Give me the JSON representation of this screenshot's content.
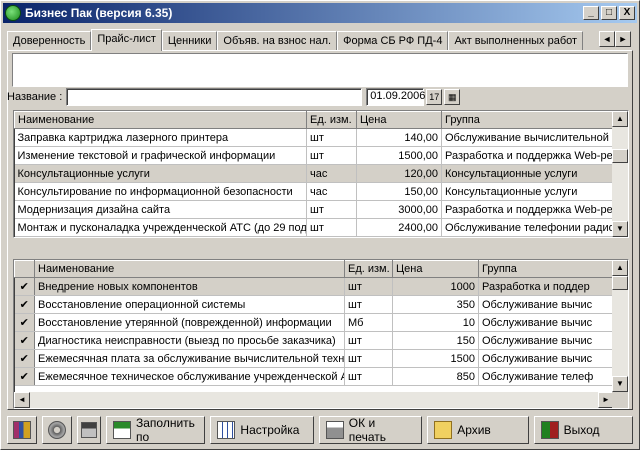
{
  "window": {
    "title": "Бизнес Пак (версия 6.35)",
    "min": "_",
    "max": "□",
    "close": "X"
  },
  "tabs": [
    {
      "label": "Доверенность"
    },
    {
      "label": "Прайс-лист"
    },
    {
      "label": "Ценники"
    },
    {
      "label": "Объяв. на взнос нал."
    },
    {
      "label": "Форма СБ РФ ПД-4"
    },
    {
      "label": "Акт выполненных работ"
    }
  ],
  "tab_scroll": {
    "left": "◄",
    "right": "►"
  },
  "filter": {
    "name_label": "Название :",
    "name_value": "",
    "date_value": "01.09.2006",
    "calendar_label": "17"
  },
  "top_grid": {
    "columns": [
      "Наименование",
      "Ед. изм.",
      "Цена",
      "Группа"
    ],
    "rows": [
      [
        "Заправка картриджа лазерного принтера",
        "шт",
        "140,00",
        "Обслуживание вычислительной т"
      ],
      [
        "Изменение текстовой и графической информации",
        "шт",
        "1500,00",
        "Разработка и поддержка Web-ре"
      ],
      [
        "Консультационные услуги",
        "час",
        "120,00",
        "Консультационные услуги"
      ],
      [
        "Консультирование по информационной безопасности",
        "час",
        "150,00",
        "Консультационные услуги"
      ],
      [
        "Модернизация дизайна сайта",
        "шт",
        "3000,00",
        "Разработка и поддержка Web-ре"
      ],
      [
        "Монтаж и пусконаладка учрежденческой АТС (до 29 под",
        "шт",
        "2400,00",
        "Обслуживание телефонии радиов"
      ]
    ],
    "selected_row": 2
  },
  "bottom_grid": {
    "columns": [
      "Наименование",
      "Ед. изм.",
      "Цена",
      "Группа"
    ],
    "check_mark": "✔",
    "rows": [
      [
        "Внедрение новых компонентов",
        "шт",
        "1000",
        "Разработка и поддер"
      ],
      [
        "Восстановление операционной системы",
        "шт",
        "350",
        "Обслуживание вычис"
      ],
      [
        "Восстановление утерянной (поврежденной) информации",
        "Мб",
        "10",
        "Обслуживание вычис"
      ],
      [
        "Диагностика неисправности (выезд по просьбе заказчика)",
        "шт",
        "150",
        "Обслуживание вычис"
      ],
      [
        "Ежемесячная плата за обслуживание вычислительной техники и",
        "шт",
        "1500",
        "Обслуживание вычис"
      ],
      [
        "Ежемесячное техническое обслуживание учрежденческой АТС",
        "шт",
        "850",
        "Обслуживание телеф"
      ]
    ],
    "selected_row": 0
  },
  "scroll_arrows": {
    "up": "▲",
    "down": "▼",
    "left": "◄",
    "right": "►"
  },
  "footer": {
    "fill_label": "Заполнить по",
    "settings_label": "Настройка",
    "ok_print_label": "ОК и печать",
    "archive_label": "Архив",
    "exit_label": "Выход"
  },
  "icons": {
    "app": "app-icon",
    "books": "books-icon",
    "gear": "gear-icon",
    "save": "floppy-icon",
    "fill": "document-icon",
    "settings": "grid-icon",
    "print": "printer-icon",
    "archive": "folder-icon",
    "exit": "door-icon"
  }
}
